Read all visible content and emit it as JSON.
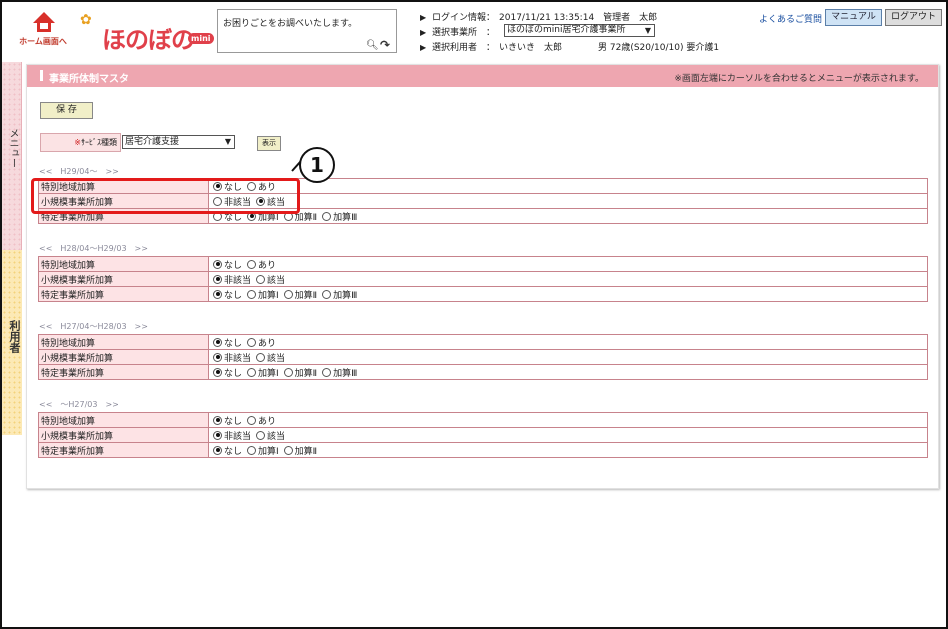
{
  "header": {
    "home_label": "ホーム画面へ",
    "logo_text": "ほのぼの",
    "logo_badge": "mini",
    "search_placeholder": "お困りごとをお調べいたします。",
    "login_label": "ログイン情報：",
    "login_value": "2017/11/21 13:35:14　管理者　太郎",
    "office_label": "選択事業所　：",
    "office_value": "ほのぼのmini居宅介護事業所",
    "user_label": "選択利用者　：",
    "user_value": "いきいき　太郎　　　　男 72歳(S20/10/10) 要介護1",
    "faq_link": "よくあるご質問",
    "manual_button": "マニュアル",
    "logout_button": "ログアウト"
  },
  "side": {
    "menu_label": "メニュー",
    "user_label": "利用者"
  },
  "panel": {
    "title": "事業所体制マスタ",
    "note": "※画面左端にカーソルを合わせるとメニューが表示されます。",
    "save_button": "保 存",
    "service_label_req": "※",
    "service_label": "ｻｰﾋﾞｽ種類",
    "service_value": "居宅介護支援",
    "show_button": "表示"
  },
  "sections": [
    {
      "period": "<<　H29/04～　>>",
      "rows": [
        {
          "label": "特別地域加算",
          "options": [
            "なし",
            "あり"
          ],
          "selected": 0
        },
        {
          "label": "小規模事業所加算",
          "options": [
            "非該当",
            "該当"
          ],
          "selected": 1
        },
        {
          "label": "特定事業所加算",
          "options": [
            "なし",
            "加算Ⅰ",
            "加算Ⅱ",
            "加算Ⅲ"
          ],
          "selected": 1
        }
      ]
    },
    {
      "period": "<<　H28/04～H29/03　>>",
      "rows": [
        {
          "label": "特別地域加算",
          "options": [
            "なし",
            "あり"
          ],
          "selected": 0
        },
        {
          "label": "小規模事業所加算",
          "options": [
            "非該当",
            "該当"
          ],
          "selected": 0
        },
        {
          "label": "特定事業所加算",
          "options": [
            "なし",
            "加算Ⅰ",
            "加算Ⅱ",
            "加算Ⅲ"
          ],
          "selected": 0
        }
      ]
    },
    {
      "period": "<<　H27/04～H28/03　>>",
      "rows": [
        {
          "label": "特別地域加算",
          "options": [
            "なし",
            "あり"
          ],
          "selected": 0
        },
        {
          "label": "小規模事業所加算",
          "options": [
            "非該当",
            "該当"
          ],
          "selected": 0
        },
        {
          "label": "特定事業所加算",
          "options": [
            "なし",
            "加算Ⅰ",
            "加算Ⅱ",
            "加算Ⅲ"
          ],
          "selected": 0
        }
      ]
    },
    {
      "period": "<<　～H27/03　>>",
      "rows": [
        {
          "label": "特別地域加算",
          "options": [
            "なし",
            "あり"
          ],
          "selected": 0
        },
        {
          "label": "小規模事業所加算",
          "options": [
            "非該当",
            "該当"
          ],
          "selected": 0
        },
        {
          "label": "特定事業所加算",
          "options": [
            "なし",
            "加算Ⅰ",
            "加算Ⅱ"
          ],
          "selected": 0
        }
      ]
    }
  ],
  "annotation": {
    "callout_number": "1",
    "highlight_color": "#e31a1a"
  },
  "colors": {
    "title_bar": "#eea6b0",
    "label_cell": "#fde3e5",
    "brand": "#e0404a"
  }
}
